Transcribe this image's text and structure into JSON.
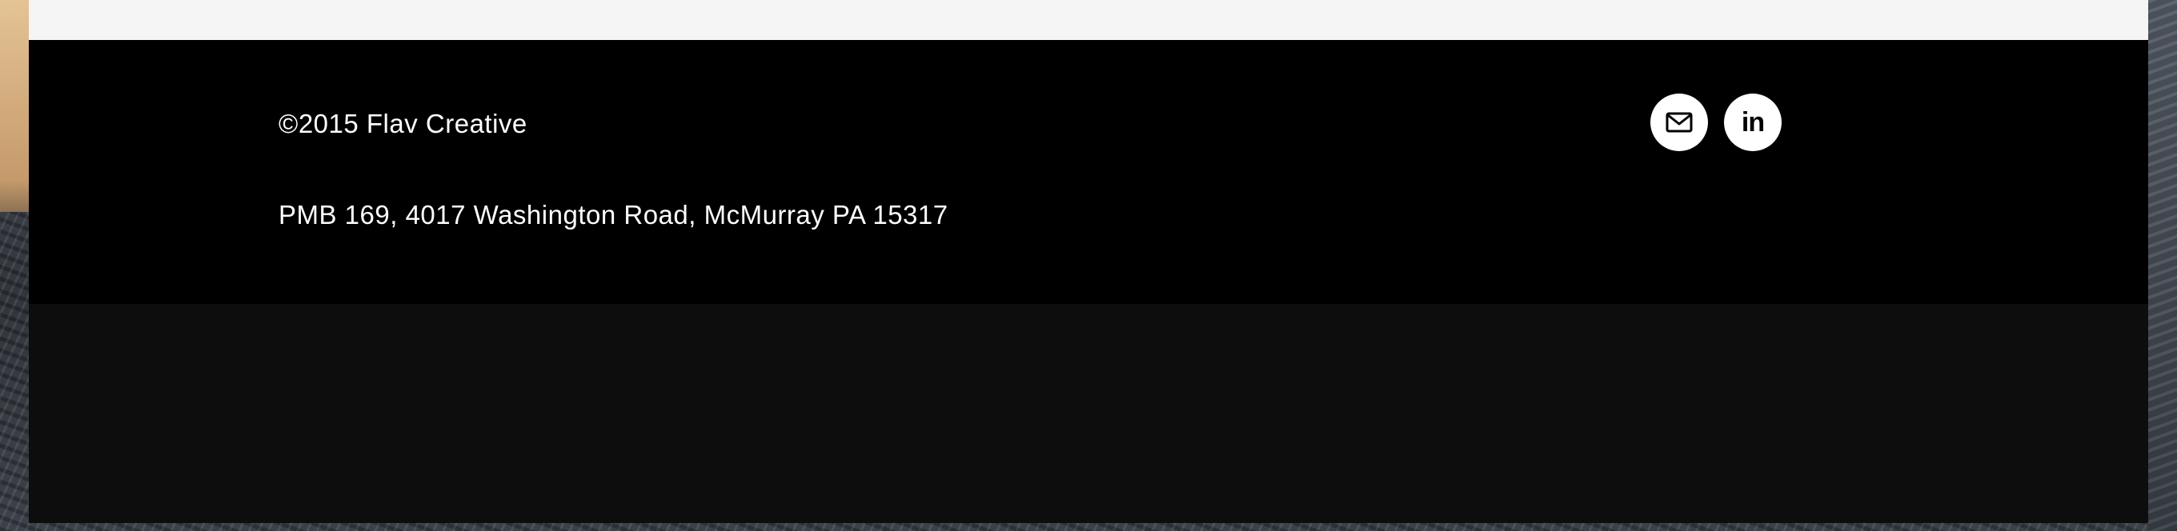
{
  "footer": {
    "copyright": "©2015 Flav Creative",
    "address": "PMB 169, 4017 Washington Road, McMurray PA 15317",
    "social": [
      {
        "icon": "email-icon"
      },
      {
        "icon": "linkedin-icon",
        "glyph": "in"
      }
    ]
  },
  "colors": {
    "footer_background": "#000000",
    "lower_background": "#0d0d0d",
    "top_strip": "#f5f5f5",
    "text": "#ffffff",
    "icon_circle": "#ffffff"
  }
}
